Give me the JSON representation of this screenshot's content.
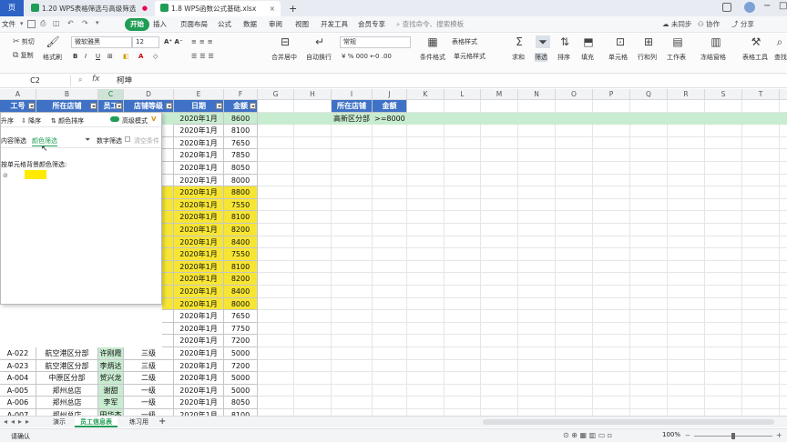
{
  "tabs": {
    "logo": "页",
    "tab1": "1.20 WPS表格筛选与高级筛选",
    "tab2": "1.8 WPS函数公式基础.xlsx",
    "add": "+"
  },
  "menu": {
    "file": "文件",
    "start": "开始",
    "insert": "插入",
    "layout": "页面布局",
    "formula": "公式",
    "data": "数据",
    "review": "审阅",
    "view": "视图",
    "dev": "开发工具",
    "member": "会员专享",
    "search": "查找命令、搜索模板",
    "sync": "未同步",
    "collab": "协作",
    "share": "分享"
  },
  "toolbar": {
    "cut": "剪切",
    "copy": "复制",
    "brush": "格式刷",
    "font": "微软雅黑",
    "size": "12",
    "numfmt": "常规",
    "merge": "合并居中",
    "wrap": "自动换行",
    "table_style": "表格样式",
    "cond": "条件格式",
    "cell_style": "单元格样式",
    "sum": "求和",
    "filter": "筛选",
    "sort": "排序",
    "fill": "填充",
    "cells": "单元格",
    "rowcol": "行和列",
    "sheets": "工作表",
    "freeze": "冻结窗格",
    "tools": "表格工具",
    "find": "查找",
    "bold": "B",
    "italic": "I",
    "underline": "U",
    "pct": "%",
    "thousand": "000"
  },
  "formula_bar": {
    "name_box": "C2",
    "fx": "fx",
    "value": "柯坤"
  },
  "columns": [
    "A",
    "B",
    "C",
    "D",
    "E",
    "F",
    "G",
    "H",
    "I",
    "J",
    "K",
    "L",
    "M",
    "N",
    "O",
    "P",
    "Q",
    "R",
    "S",
    "T"
  ],
  "headers": {
    "a": "工号",
    "b": "所在店铺",
    "c": "员工",
    "d": "店铺等级",
    "e": "日期",
    "f": "金额"
  },
  "dates": [
    "2020年1月",
    "2020年1月",
    "2020年1月",
    "2020年1月",
    "2020年1月",
    "2020年1月",
    "2020年1月",
    "2020年1月",
    "2020年1月",
    "2020年1月",
    "2020年1月",
    "2020年1月",
    "2020年1月",
    "2020年1月",
    "2020年1月",
    "2020年1月",
    "2020年1月",
    "2020年1月",
    "2020年1月",
    "2020年1月",
    "2020年1月",
    "2020年1月",
    "2020年1月",
    "2020年1月",
    "2020年1月"
  ],
  "amounts": [
    "8600",
    "8100",
    "7650",
    "7850",
    "8050",
    "8000",
    "8800",
    "7550",
    "8100",
    "8200",
    "8400",
    "7550",
    "8100",
    "8200",
    "8400",
    "8000",
    "7650",
    "7750",
    "7200",
    "5000",
    "7200",
    "5000",
    "5000",
    "8050",
    "8100"
  ],
  "lower_rows": [
    {
      "a": "A-022",
      "b": "航空港区分部",
      "c": "许刚霞",
      "d": "三级"
    },
    {
      "a": "A-023",
      "b": "航空港区分部",
      "c": "李炳达",
      "d": "三级"
    },
    {
      "a": "A-004",
      "b": "中原区分部",
      "c": "贺兴龙",
      "d": "二级"
    },
    {
      "a": "A-005",
      "b": "郑州总店",
      "c": "谢甜",
      "d": "一级"
    },
    {
      "a": "A-006",
      "b": "郑州总店",
      "c": "李军",
      "d": "一级"
    },
    {
      "a": "A-007",
      "b": "郑州总店",
      "c": "田华杰",
      "d": "一级"
    }
  ],
  "criteria": {
    "h1": "所在店铺",
    "h2": "金额",
    "v1": "高新区分部",
    "v2": ">=8000"
  },
  "filter_panel": {
    "asc": "升序",
    "desc": "降序",
    "color_sort": "颜色排序",
    "advanced": "高级模式",
    "vip": "V",
    "content_filter": "内容筛选",
    "color_filter": "颜色筛选",
    "number_filter": "数字筛选",
    "clear": "清空条件",
    "bg_label": "按单元格背景颜色筛选:",
    "swatch_color": "#ffea00"
  },
  "sheets": {
    "s1": "演示",
    "s2": "员工信息表",
    "s3": "练习用",
    "add": "+"
  },
  "status": {
    "text": "请确认",
    "zoom": "100%"
  },
  "colors": {
    "header_blue": "#3f72c6",
    "highlight_yellow": "#f7e533",
    "criteria_green": "#c8ecd0",
    "accent_green": "#1f9d55"
  }
}
